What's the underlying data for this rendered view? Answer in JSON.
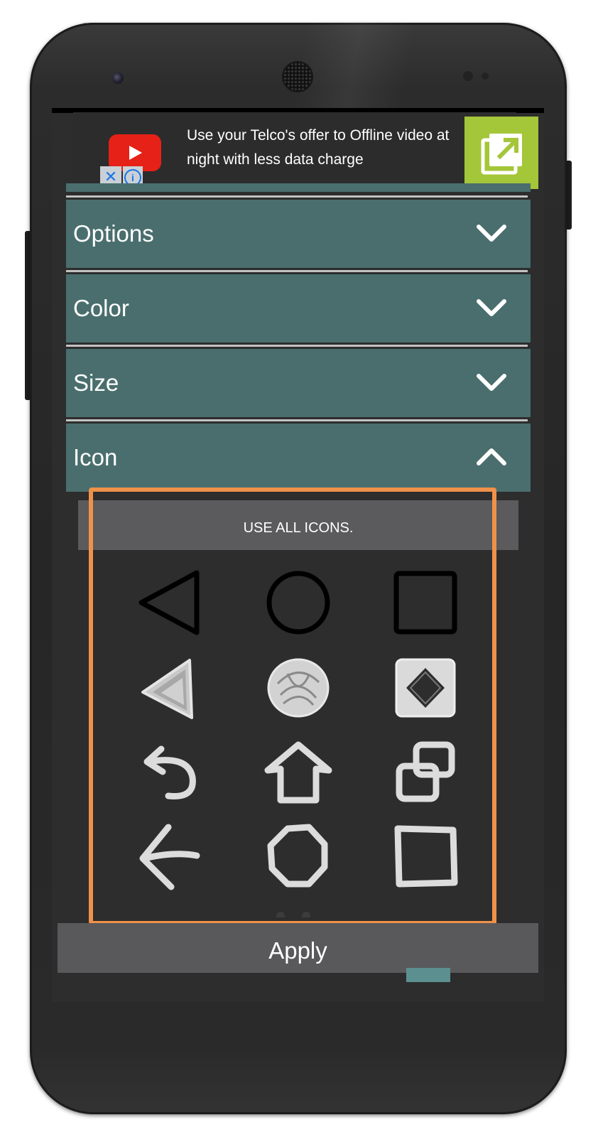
{
  "ad": {
    "text": "Use your Telco's offer to Offline video at night with less data charge",
    "close_glyph": "✕",
    "info_glyph": "i",
    "logo_icon": "youtube-play-icon",
    "cta_icon": "external-open-icon",
    "cta_color": "#a4c639"
  },
  "accordion": {
    "items": [
      {
        "label": "Options",
        "state": "collapsed",
        "icon": "chevron-down-icon"
      },
      {
        "label": "Color",
        "state": "collapsed",
        "icon": "chevron-down-icon"
      },
      {
        "label": "Size",
        "state": "collapsed",
        "icon": "chevron-down-icon"
      },
      {
        "label": "Icon",
        "state": "expanded",
        "icon": "chevron-up-icon"
      }
    ],
    "header_color": "#4a6e6e"
  },
  "icon_panel": {
    "use_all_label": "USE ALL ICONS.",
    "icons": [
      "triangle-outline-icon",
      "circle-outline-icon",
      "square-outline-icon",
      "triangle-sketch-icon",
      "circle-sketch-icon",
      "square-sketch-icon",
      "undo-arrow-icon",
      "home-arrow-icon",
      "overlap-squares-icon",
      "left-arrow-icon",
      "hand-drawn-circle-icon",
      "hand-drawn-square-icon"
    ]
  },
  "apply_label": "Apply",
  "highlight_color": "#f0914a"
}
